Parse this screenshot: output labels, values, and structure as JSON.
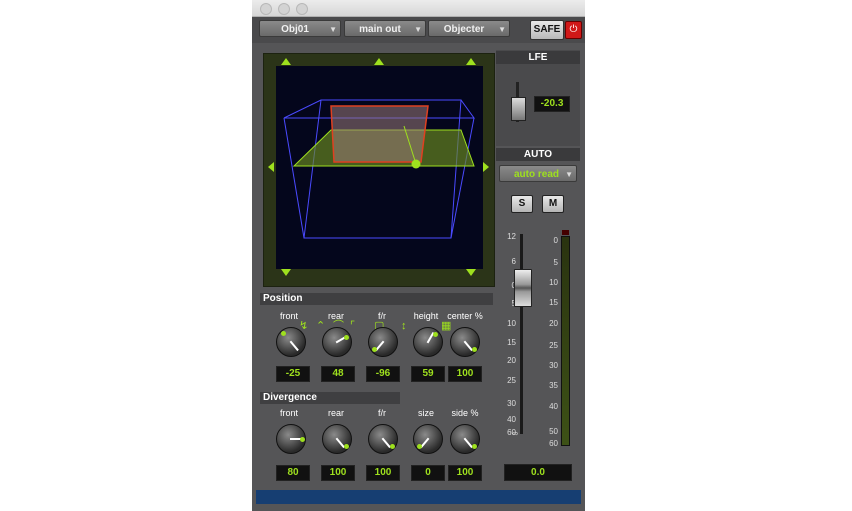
{
  "toolbar": {
    "track": "Obj01",
    "output": "main out",
    "plugin": "Objecter",
    "safe_label": "SAFE",
    "power_icon": "power-icon"
  },
  "colors": {
    "accent": "#9ee01e",
    "background": "#555557",
    "room_box": "#4a4aff",
    "object": "#e04020"
  },
  "position": {
    "title": "Position",
    "knobs": [
      {
        "label": "front",
        "value": "-25"
      },
      {
        "label": "rear",
        "value": "48"
      },
      {
        "label": "f/r",
        "value": "-96"
      },
      {
        "label": "height",
        "value": "59"
      },
      {
        "label": "center %",
        "value": "100"
      }
    ]
  },
  "divergence": {
    "title": "Divergence",
    "knobs": [
      {
        "label": "front",
        "value": "80"
      },
      {
        "label": "rear",
        "value": "100"
      },
      {
        "label": "f/r",
        "value": "100"
      },
      {
        "label": "size",
        "value": "0"
      },
      {
        "label": "side %",
        "value": "100"
      }
    ]
  },
  "lfe": {
    "title": "LFE",
    "value": "-20.3"
  },
  "auto": {
    "title": "AUTO",
    "mode": "auto read",
    "solo": "S",
    "mute": "M"
  },
  "fader": {
    "scale": [
      "12",
      "6",
      "0",
      "5",
      "10",
      "15",
      "20",
      "25",
      "30",
      "40",
      "60",
      "∞"
    ],
    "meter_scale": [
      "0",
      "5",
      "10",
      "15",
      "20",
      "25",
      "30",
      "35",
      "40",
      "50",
      "60"
    ],
    "value": "0.0"
  }
}
